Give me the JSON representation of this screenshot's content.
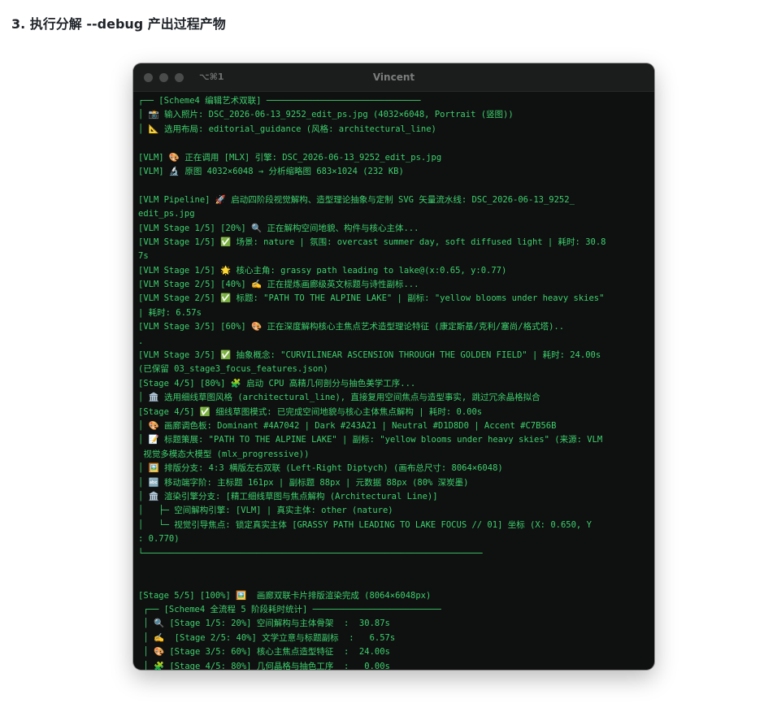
{
  "heading": "3. 执行分解 --debug 产出过程产物",
  "window": {
    "shortcut": "⌥⌘1",
    "title": "Vincent",
    "traffic_light_color": "#4a4c4b",
    "background": "#0f1110",
    "text_color": "#3ecf6e"
  },
  "terminal_lines": [
    "┌── [Scheme4 编辑艺术双联] ──────────────────────────────",
    "│ 📸 输入照片: DSC_2026-06-13_9252_edit_ps.jpg (4032×6048, Portrait (竖图))",
    "│ 📐 选用布局: editorial_guidance (风格: architectural_line)",
    "",
    "[VLM] 🎨 正在调用 [MLX] 引擎: DSC_2026-06-13_9252_edit_ps.jpg",
    "[VLM] 🔬 原图 4032×6048 → 分析缩略图 683×1024 (232 KB)",
    "",
    "[VLM Pipeline] 🚀 启动四阶段视觉解构、造型理论抽象与定制 SVG 矢量流水线: DSC_2026-06-13_9252_",
    "edit_ps.jpg",
    "[VLM Stage 1/5] [20%] 🔍 正在解构空间地貌、构件与核心主体...",
    "[VLM Stage 1/5] ✅ 场景: nature | 氛围: overcast summer day, soft diffused light | 耗时: 30.8",
    "7s",
    "[VLM Stage 1/5] 🌟 核心主角: grassy path leading to lake@(x:0.65, y:0.77)",
    "[VLM Stage 2/5] [40%] ✍️ 正在提炼画廊级英文标题与诗性副标...",
    "[VLM Stage 2/5] ✅ 标题: \"PATH TO THE ALPINE LAKE\" | 副标: \"yellow blooms under heavy skies\"",
    "| 耗时: 6.57s",
    "[VLM Stage 3/5] [60%] 🎨 正在深度解构核心主焦点艺术造型理论特征 (康定斯基/克利/塞尚/格式塔)..",
    ".",
    "[VLM Stage 3/5] ✅ 抽象概念: \"CURVILINEAR ASCENSION THROUGH THE GOLDEN FIELD\" | 耗时: 24.00s",
    "(已保留 03_stage3_focus_features.json)",
    "[Stage 4/5] [80%] 🧩 启动 CPU 高精几何剖分与抽色美学工序...",
    "│ 🏛️ 选用细线草图风格 (architectural_line), 直接复用空间焦点与造型事实, 跳过冗余晶格拟合",
    "[Stage 4/5] ✅ 细线草图模式: 已完成空间地貌与核心主体焦点解构 | 耗时: 0.00s",
    "│ 🎨 画廊调色板: Dominant #4A7042 | Dark #243A21 | Neutral #D1D8D0 | Accent #C7B56B",
    "│ 📝 标题策展: \"PATH TO THE ALPINE LAKE\" | 副标: \"yellow blooms under heavy skies\" (来源: VLM",
    " 视觉多模态大模型 (mlx_progressive))",
    "│ 🖼️ 排版分支: 4:3 横版左右双联 (Left-Right Diptych) (画布总尺寸: 8064×6048)",
    "│ 🔤 移动端字阶: 主标题 161px | 副标题 88px | 元数据 88px (80% 深炭墨)",
    "│ 🏛️ 渲染引擎分支: [精工细线草图与焦点解构 (Architectural Line)]",
    "│   ├─ 空间解构引擎: [VLM] | 真实主体: other (nature)",
    "│   └─ 视觉引导焦点: 锁定真实主体 [GRASSY PATH LEADING TO LAKE FOCUS // 01] 坐标 (X: 0.650, Y",
    ": 0.770)",
    "└──────────────────────────────────────────────────────────────────",
    "",
    "",
    "[Stage 5/5] [100%] 🖼️  画廊双联卡片排版渲染完成 (8064×6048px)",
    " ┌── [Scheme4 全流程 5 阶段耗时统计] ─────────────────────────",
    " │ 🔍 [Stage 1/5: 20%] 空间解构与主体骨架  :  30.87s",
    " │ ✍️  [Stage 2/5: 40%] 文学立意与标题副标  :   6.57s",
    " │ 🎨 [Stage 3/5: 60%] 核心主焦点造型特征  :  24.00s",
    " │ 🧩 [Stage 4/5: 80%] 几何晶格与抽色工序  :   0.00s"
  ]
}
